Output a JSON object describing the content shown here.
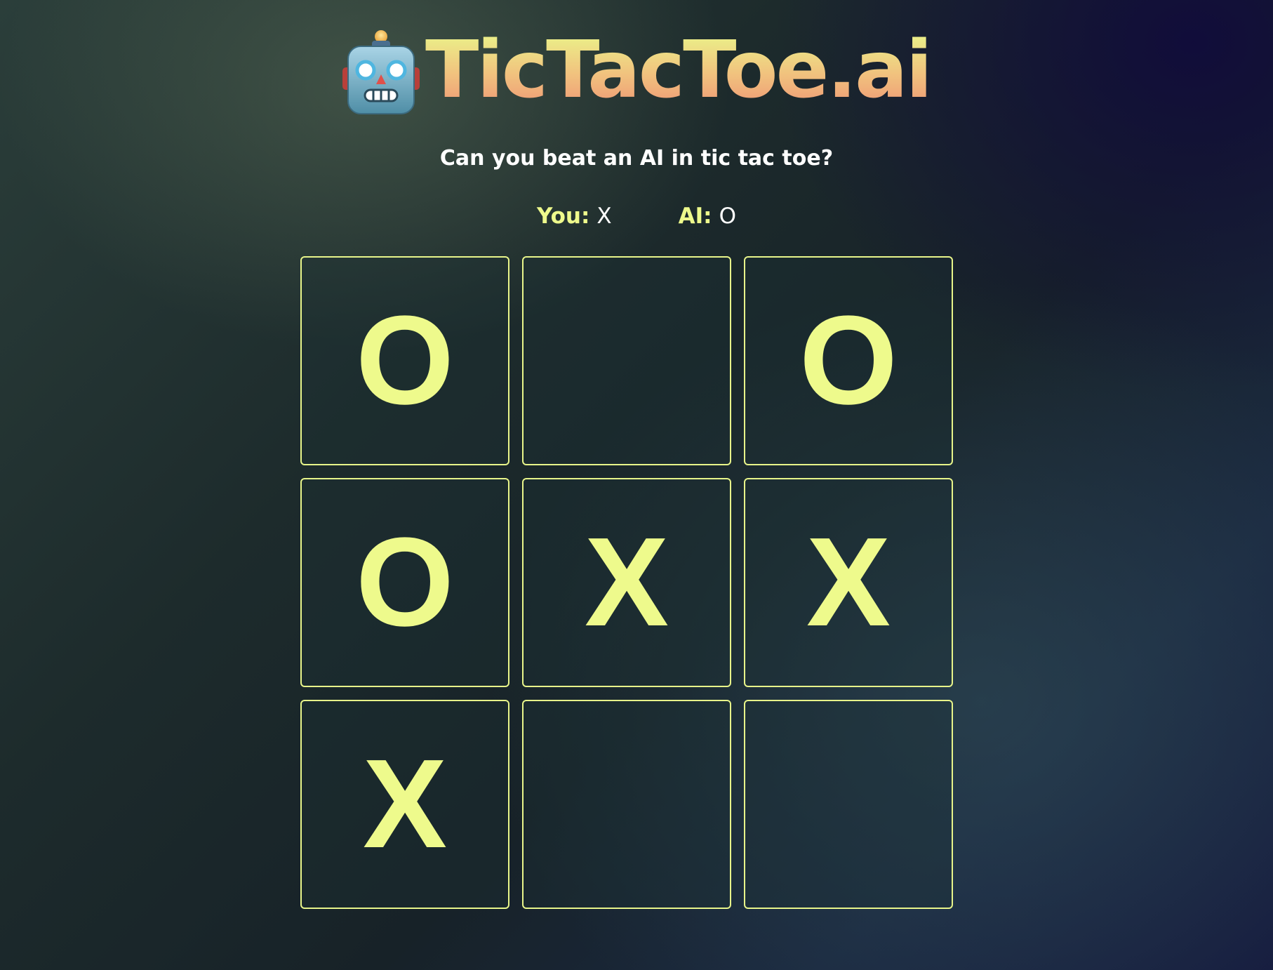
{
  "header": {
    "logo_icon": "robot-icon",
    "title": "TicTacToe.ai"
  },
  "subtitle": "Can you beat an AI in tic tac toe?",
  "players": {
    "you_label": "You:",
    "you_mark": "X",
    "ai_label": "AI:",
    "ai_mark": "O"
  },
  "board": {
    "cells": [
      "O",
      "",
      "O",
      "O",
      "X",
      "X",
      "X",
      "",
      ""
    ]
  },
  "colors": {
    "accent": "#eefa8c",
    "title_gradient_top": "#eaf58a",
    "title_gradient_bottom": "#ee9775"
  }
}
